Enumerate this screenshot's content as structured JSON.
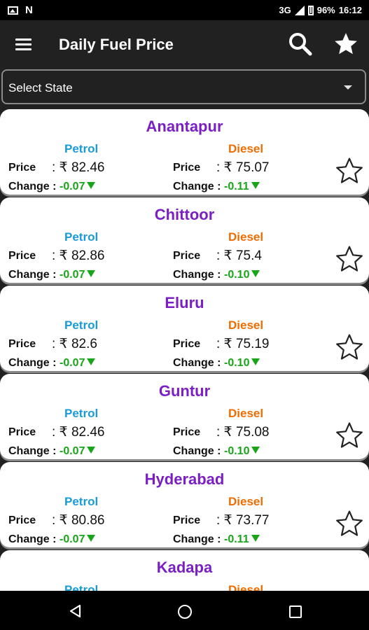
{
  "status_bar": {
    "network": "3G",
    "battery": "96%",
    "time": "16:12",
    "n_icon": "N"
  },
  "app_bar": {
    "title": "Daily Fuel Price"
  },
  "selector": {
    "value": "Select State"
  },
  "labels": {
    "petrol": "Petrol",
    "diesel": "Diesel",
    "price": "Price",
    "change": "Change :",
    "price_sep": ": ₹ "
  },
  "cities": [
    {
      "name": "Anantapur",
      "petrol_price": "82.46",
      "petrol_change": "-0.07",
      "diesel_price": "75.07",
      "diesel_change": "-0.11"
    },
    {
      "name": "Chittoor",
      "petrol_price": "82.86",
      "petrol_change": "-0.07",
      "diesel_price": "75.4",
      "diesel_change": "-0.10"
    },
    {
      "name": "Eluru",
      "petrol_price": "82.6",
      "petrol_change": "-0.07",
      "diesel_price": "75.19",
      "diesel_change": "-0.10"
    },
    {
      "name": "Guntur",
      "petrol_price": "82.46",
      "petrol_change": "-0.07",
      "diesel_price": "75.08",
      "diesel_change": "-0.10"
    },
    {
      "name": "Hyderabad",
      "petrol_price": "80.86",
      "petrol_change": "-0.07",
      "diesel_price": "73.77",
      "diesel_change": "-0.11"
    },
    {
      "name": "Kadapa",
      "petrol_price": "",
      "petrol_change": "",
      "diesel_price": "",
      "diesel_change": ""
    }
  ],
  "colors": {
    "city": "#7b1fc4",
    "petrol": "#1a9bd7",
    "diesel": "#ef6c00",
    "change_down": "#19a519",
    "app_bar": "#212121"
  },
  "icons": {
    "menu": "hamburger-menu-icon",
    "search": "search-icon",
    "favorite": "star-icon",
    "card_favorite": "star-outline-icon",
    "change_down": "down-triangle-icon"
  }
}
